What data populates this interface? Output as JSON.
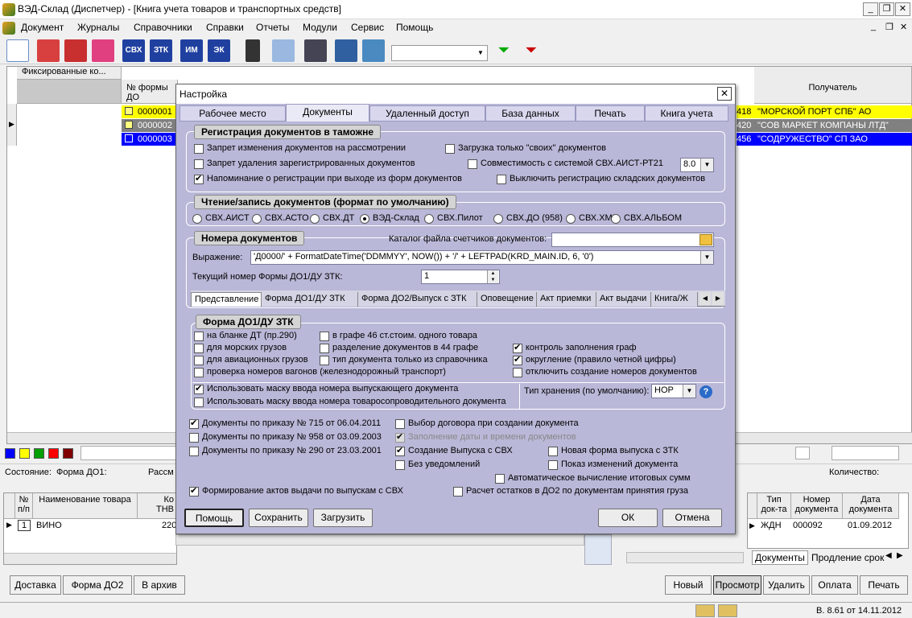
{
  "window": {
    "title": "ВЭД-Склад (Диспетчер) - [Книга учета товаров и транспортных средств]"
  },
  "menu": [
    "Документ",
    "Журналы",
    "Справочники",
    "Справки",
    "Отчеты",
    "Модули",
    "Сервис",
    "Помощь"
  ],
  "toolbar": {
    "icons": [
      "document-icon",
      "book-red-icon",
      "book-red2-icon",
      "book-pink-icon",
      "svh-icon",
      "ztk-icon",
      "im-icon",
      "ek-icon",
      "traffic-light-icon",
      "search-icon",
      "list-icon",
      "columns-icon",
      "exit-door-icon",
      "filter-add-icon",
      "filter-remove-icon"
    ],
    "labels": {
      "svh": "СВХ",
      "ztk": "ЗТК",
      "im": "ИМ",
      "ek": "ЭК"
    }
  },
  "grid": {
    "fixed_header": "Фиксированные ко...",
    "col_form": "№ формы ДО",
    "col_receiver": "Получатель",
    "rows": [
      {
        "num": "0000001",
        "tail": "418",
        "receiver": "\"МОРСКОЙ ПОРТ СПБ\" АО",
        "color": "#ffff00"
      },
      {
        "num": "0000002",
        "tail": "420",
        "receiver": "\"СОВ МАРКЕТ КОМПАНЫ ЛТД\"",
        "color": "#808080"
      },
      {
        "num": "0000003",
        "tail": "456",
        "receiver": "\"СОДРУЖЕСТВО\" СП ЗАО",
        "color": "#0000ff"
      }
    ]
  },
  "status_colors": [
    "#0000ff",
    "#ffff00",
    "#00a000",
    "#ff0000",
    "#800000"
  ],
  "state": {
    "label": "Состояние:",
    "form": "Форма ДО1:",
    "rassm": "Рассм",
    "qty": "Количество:"
  },
  "goods": {
    "h_num": "№",
    "h_pp": "п/п",
    "h_name": "Наименование товара",
    "h_code": "Ко",
    "h_tnved": "ТНВ",
    "row_num": "1",
    "row_name": "ВИНО",
    "row_code": "220"
  },
  "docs": {
    "h_type": "Тип",
    "h_type2": "док-та",
    "h_num": "Номер",
    "h_num2": "документа",
    "h_date": "Дата",
    "h_date2": "документа",
    "row": {
      "type": "ЖДН",
      "num": "000092",
      "date": "01.09.2012"
    },
    "tab1": "Документы",
    "tab2": "Продление срок"
  },
  "bottom_left": [
    "Доставка",
    "Форма ДО2",
    "В архив"
  ],
  "bottom_right": [
    "Новый",
    "Просмотр",
    "Удалить",
    "Оплата",
    "Печать"
  ],
  "version": "В. 8.61 от 14.11.2012",
  "dialog": {
    "title": "Настройка",
    "tabs": [
      "Рабочее место",
      "Документы",
      "Удаленный доступ",
      "База данных",
      "Печать",
      "Книга учета"
    ],
    "reg": {
      "title": "Регистрация документов в таможне",
      "items": [
        {
          "t": "Запрет изменения документов на рассмотрении",
          "on": false
        },
        {
          "t": "Загрузка только \"своих\" документов",
          "on": false
        },
        {
          "t": "Запрет удаления зарегистрированных документов",
          "on": false
        },
        {
          "t": "Совместимость с системой СВХ.АИСТ-РТ21",
          "on": false
        },
        {
          "t": "Напоминание о регистрации при выходе из форм документов",
          "on": true
        },
        {
          "t": "Выключить регистрацию складских документов",
          "on": false
        }
      ],
      "version": "8.0"
    },
    "rw": {
      "title": "Чтение/запись документов (формат по умолчанию)",
      "options": [
        "СВХ.АИСТ",
        "СВХ.АСТО",
        "СВХ.ДТ",
        "ВЭД-Склад",
        "СВХ.Пилот",
        "СВХ.ДО (958)",
        "СВХ.XML",
        "СВХ.АЛЬБОМ"
      ],
      "selected": 3
    },
    "nums": {
      "title": "Номера документов",
      "catalog_label": "Каталог файла счетчиков документов:",
      "expr_label": "Выражение:",
      "expr": "'Д0000/' + FormatDateTime('DDMMYY', NOW()) + '/' + LEFTPAD(KRD_MAIN.ID, 6, '0')",
      "cur_label": "Текущий номер Формы ДО1/ДУ ЗТК:",
      "cur": "1"
    },
    "subtabs": [
      "Представление",
      "Форма ДО1/ДУ ЗТК",
      "Форма ДО2/Выпуск с ЗТК",
      "Оповещение",
      "Акт приемки",
      "Акт выдачи",
      "Книга/Ж"
    ],
    "do1": {
      "title": "Форма ДО1/ДУ ЗТК",
      "items": [
        {
          "t": "на бланке ДТ (пр.290)",
          "on": false
        },
        {
          "t": "в графе 46 ст.стоим. одного товара",
          "on": false
        },
        {
          "t": "для морских грузов",
          "on": false
        },
        {
          "t": "разделение документов в 44 графе",
          "on": false
        },
        {
          "t": "контроль заполнения граф",
          "on": true
        },
        {
          "t": "для авиационных грузов",
          "on": false
        },
        {
          "t": "тип документа только из справочника",
          "on": false
        },
        {
          "t": "округление (правило четной цифры)",
          "on": true
        },
        {
          "t": "проверка номеров вагонов (железнодорожный транспорт)",
          "on": false
        },
        {
          "t": "отключить создание номеров документов",
          "on": false
        },
        {
          "t": "Использовать маску ввода номера выпускающего документа",
          "on": true
        },
        {
          "t": "Использовать маску ввода номера товаросопроводительного документа",
          "on": false
        }
      ],
      "storage_label": "Тип хранения (по умолчанию):",
      "storage": "НОР"
    },
    "misc": [
      {
        "t": "Документы по приказу № 715 от 06.04.2011",
        "on": true
      },
      {
        "t": "Выбор договора при создании документа",
        "on": false
      },
      {
        "t": "Документы по приказу № 958 от 03.09.2003",
        "on": false
      },
      {
        "t": "Заполнение даты и времени документов",
        "on": true,
        "disabled": true
      },
      {
        "t": "Документы по приказу № 290 от 23.03.2001",
        "on": false
      },
      {
        "t": "Создание Выпуска с СВХ",
        "on": true
      },
      {
        "t": "Новая форма выпуска с ЗТК",
        "on": false
      },
      {
        "t": "Без уведомлений",
        "on": false
      },
      {
        "t": "Показ изменений документа",
        "on": false
      },
      {
        "t": "Автоматическое вычисление итоговых сумм",
        "on": false
      },
      {
        "t": "Формирование актов выдачи по выпускам с СВХ",
        "on": true
      },
      {
        "t": "Расчет остатков в ДО2 по документам принятия груза",
        "on": false
      }
    ],
    "buttons": {
      "help": "Помощь",
      "save": "Сохранить",
      "load": "Загрузить",
      "ok": "ОК",
      "cancel": "Отмена"
    }
  }
}
